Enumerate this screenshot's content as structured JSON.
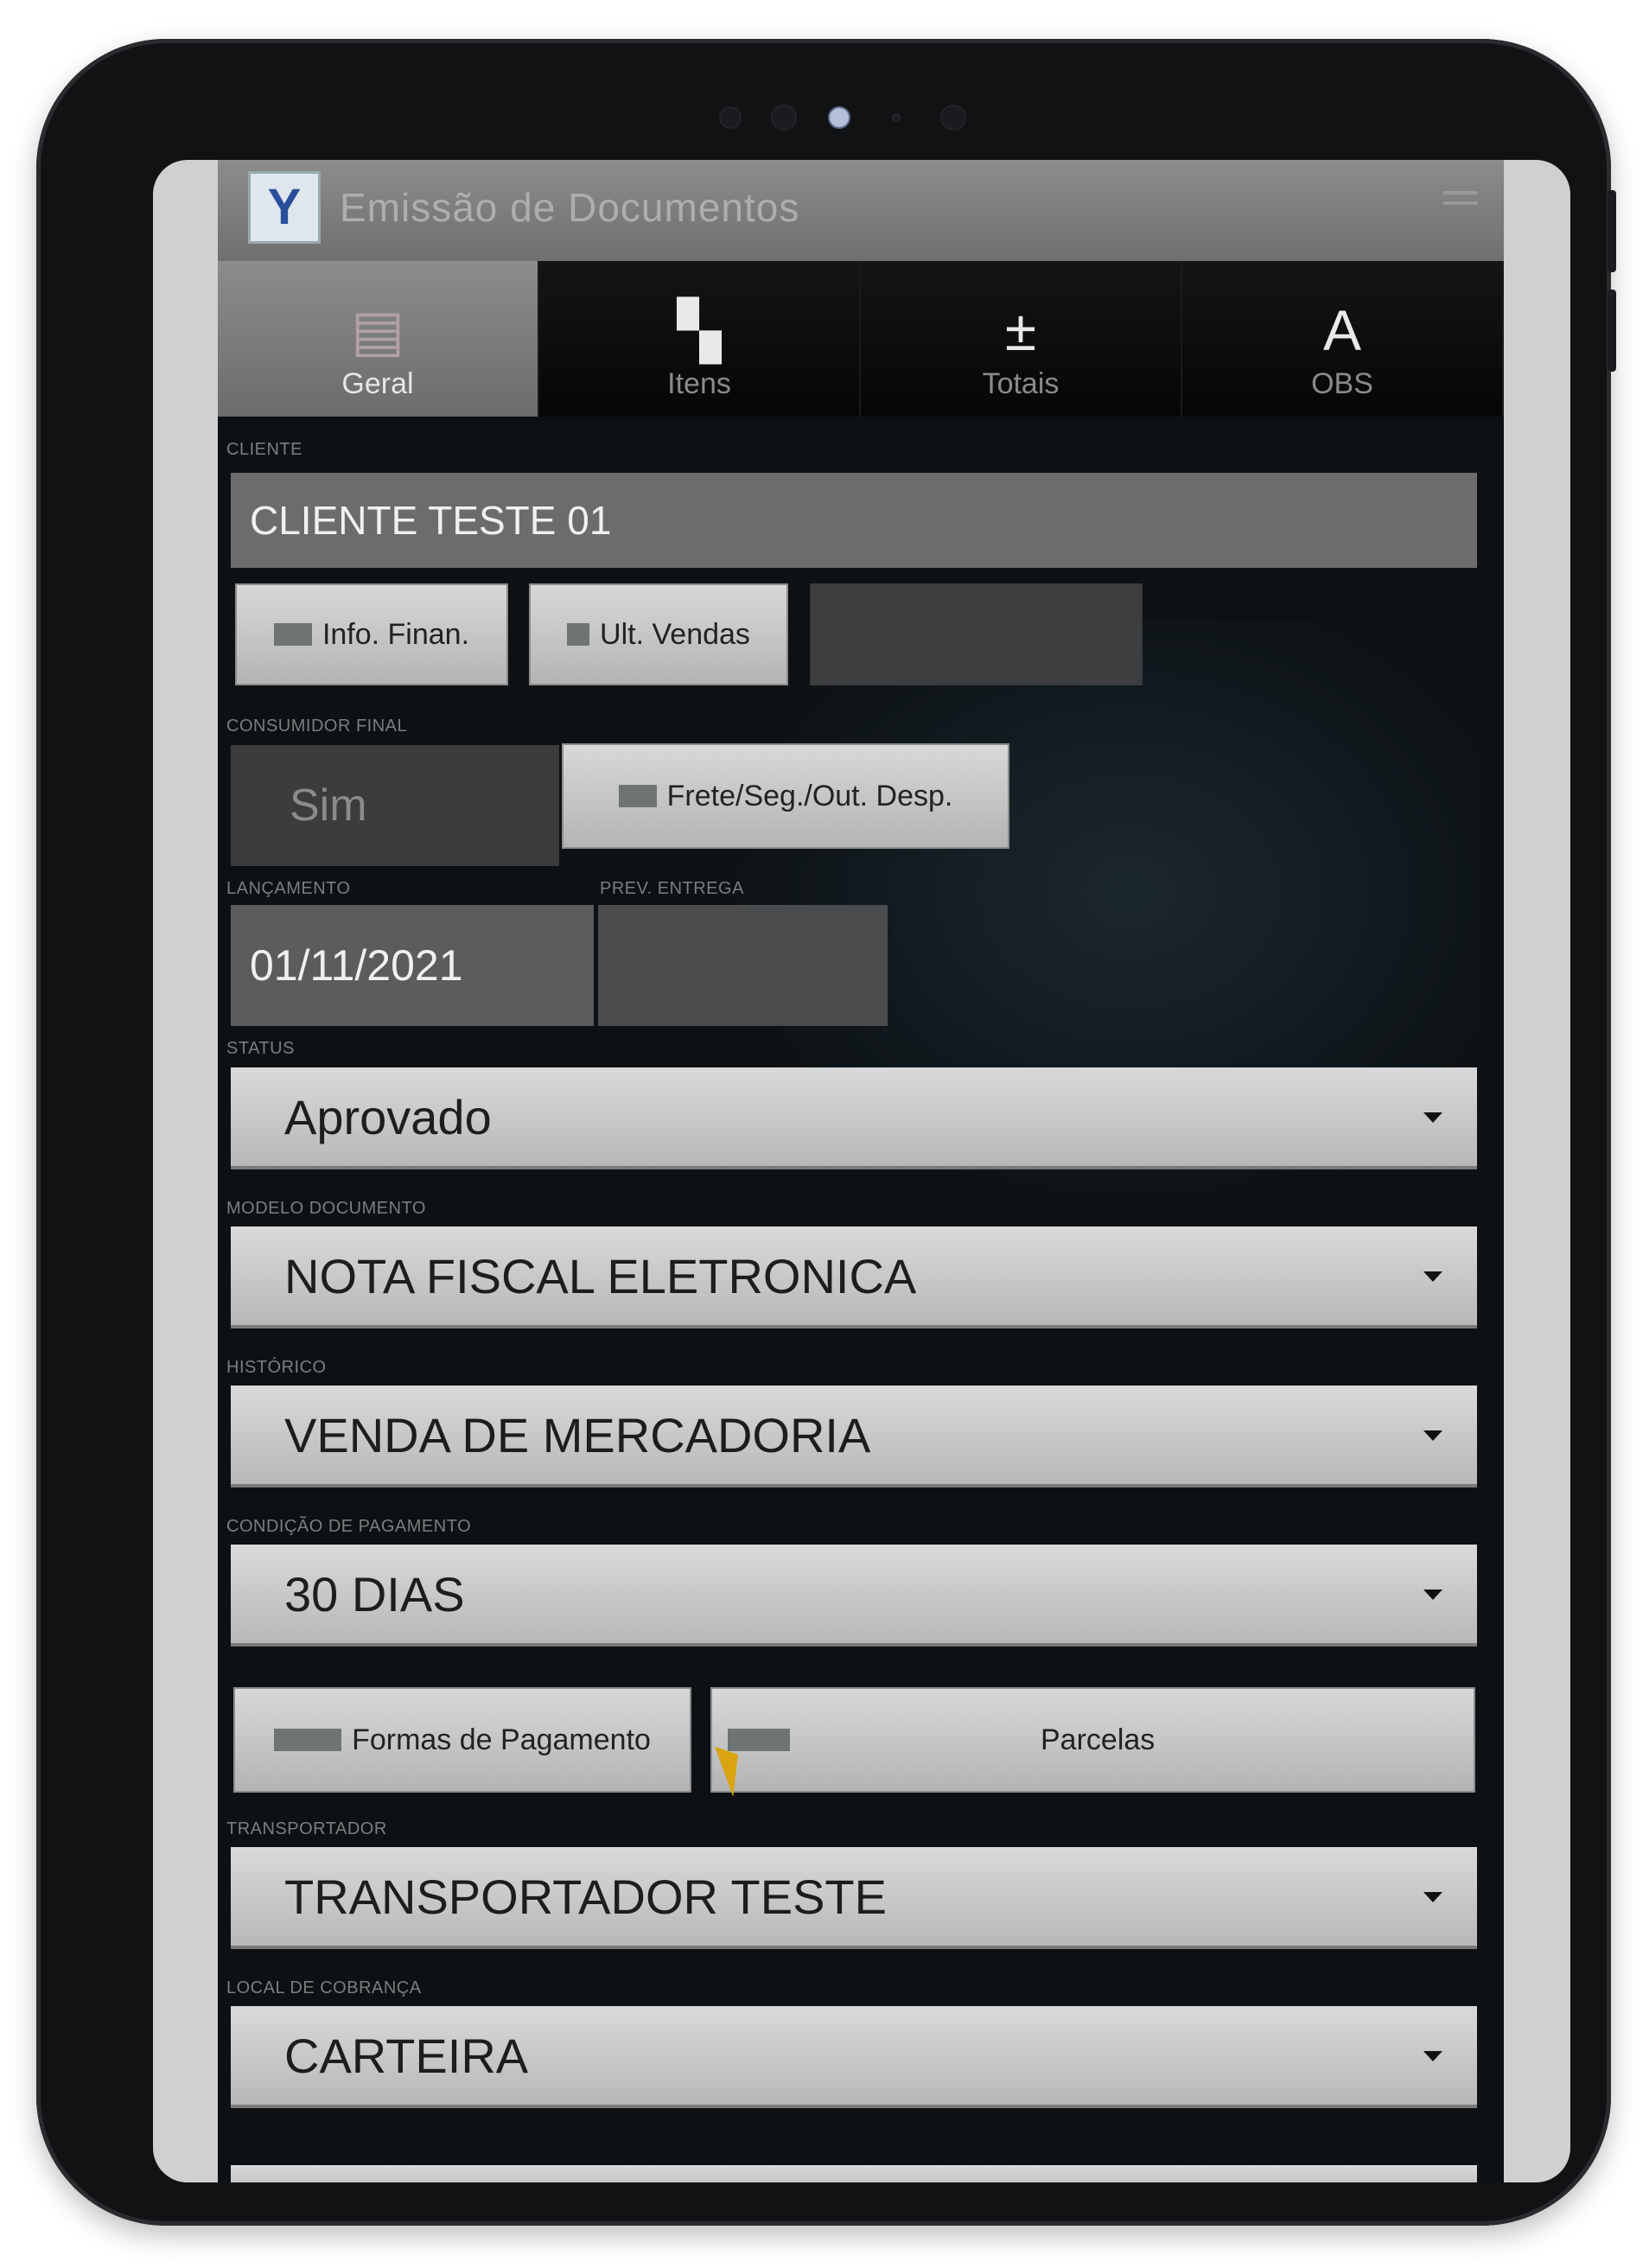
{
  "window": {
    "title": "Emissão de Documentos"
  },
  "tabs": [
    {
      "label": "Geral",
      "icon": "document-icon",
      "active": true
    },
    {
      "label": "Itens",
      "icon": "shirt-icon",
      "active": false
    },
    {
      "label": "Totais",
      "icon": "calculator-icon",
      "active": false
    },
    {
      "label": "OBS",
      "icon": "text-icon",
      "active": false
    }
  ],
  "cliente": {
    "label": "CLIENTE",
    "value": "CLIENTE TESTE 01"
  },
  "cliente_buttons": {
    "info_finan": "Info. Finan.",
    "ult_vendas": "Ult. Vendas"
  },
  "consumidor": {
    "label": "CONSUMIDOR FINAL",
    "value": "Sim",
    "frete_button": "Frete/Seg./Out. Desp."
  },
  "lancamento": {
    "label": "LANÇAMENTO",
    "value": "01/11/2021"
  },
  "prev_entrega": {
    "label": "PREV. ENTREGA",
    "value": ""
  },
  "status": {
    "label": "STATUS",
    "value": "Aprovado"
  },
  "modelo": {
    "label": "MODELO DOCUMENTO",
    "value": "NOTA FISCAL ELETRONICA"
  },
  "historico": {
    "label": "HISTÓRICO",
    "value": "VENDA DE MERCADORIA"
  },
  "condicao": {
    "label": "CONDIÇÃO DE PAGAMENTO",
    "value": "30 DIAS"
  },
  "pagamento_buttons": {
    "formas": "Formas de Pagamento",
    "parcelas": "Parcelas"
  },
  "transportador": {
    "label": "TRANSPORTADOR",
    "value": "TRANSPORTADOR TESTE"
  },
  "local_cobranca": {
    "label": "LOCAL DE COBRANÇA",
    "value": "CARTEIRA"
  },
  "next_field": {
    "label": ""
  }
}
